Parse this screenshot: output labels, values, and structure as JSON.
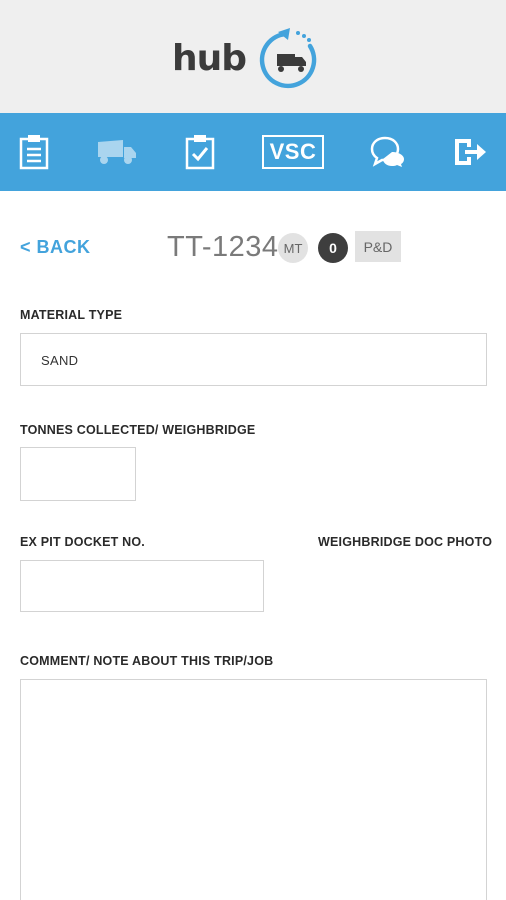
{
  "app": {
    "logo_text": "hub"
  },
  "nav": {
    "vsc_label": "VSC",
    "items": [
      "clipboard-icon",
      "truck-icon",
      "checklist-icon",
      "vsc",
      "chat-icon",
      "exit-icon"
    ]
  },
  "trip": {
    "back_label": "< BACK",
    "plate": "TT-1234",
    "mt_badge": "MT",
    "count_badge": "0",
    "pd_badge": "P&D"
  },
  "form": {
    "material_type_label": "MATERIAL TYPE",
    "material_type_value": "SAND",
    "tonnes_label": "TONNES COLLECTED/ WEIGHBRIDGE",
    "tonnes_value": "",
    "docket_label": "EX PIT DOCKET NO.",
    "docket_value": "",
    "photo_label": "WEIGHBRIDGE DOC PHOTO",
    "comment_label": "COMMENT/ NOTE ABOUT THIS TRIP/JOB",
    "comment_value": ""
  },
  "colors": {
    "accent": "#43a3dc",
    "header_bg": "#efefef",
    "badge_dark": "#3e3e3e",
    "badge_light": "#e2e2e2"
  }
}
